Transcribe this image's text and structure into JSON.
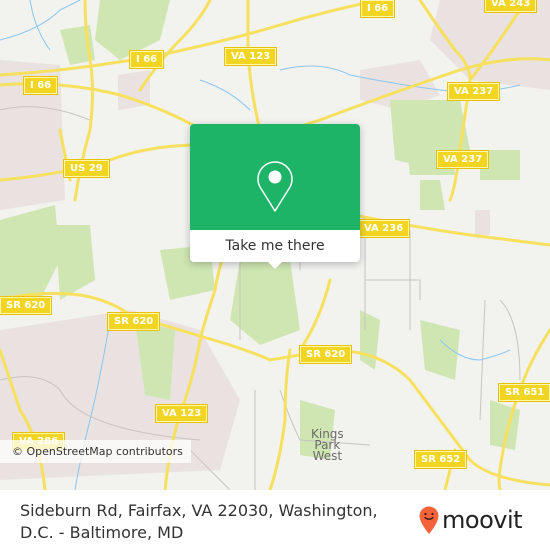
{
  "map": {
    "road_labels": [
      {
        "id": "i66-top",
        "text": "I 66"
      },
      {
        "id": "i66-mid",
        "text": "I 66"
      },
      {
        "id": "i66-left",
        "text": "I 66"
      },
      {
        "id": "va123-top",
        "text": "VA 123"
      },
      {
        "id": "va243",
        "text": "VA 243"
      },
      {
        "id": "va237-upper",
        "text": "VA 237"
      },
      {
        "id": "va237-lower",
        "text": "VA 237"
      },
      {
        "id": "us29",
        "text": "US 29"
      },
      {
        "id": "va236",
        "text": "VA 236"
      },
      {
        "id": "sr620-left",
        "text": "SR 620"
      },
      {
        "id": "sr620-mid",
        "text": "SR 620"
      },
      {
        "id": "sr620-right",
        "text": "SR 620"
      },
      {
        "id": "va123-bottom",
        "text": "VA 123"
      },
      {
        "id": "va286",
        "text": "VA 286"
      },
      {
        "id": "sr651",
        "text": "SR 651"
      },
      {
        "id": "sr652",
        "text": "SR 652"
      }
    ],
    "place_labels": [
      {
        "id": "kings-park-west",
        "lines": [
          "Kings",
          "Park",
          "West"
        ]
      }
    ],
    "attribution": "© OpenStreetMap contributors",
    "colors": {
      "background": "#f2f2ef",
      "park": "#c9e3a9",
      "urban": "#e8e0df",
      "road_major": "#f6e05e",
      "water": "#8cc6f0"
    }
  },
  "popup": {
    "button_label": "Take me there",
    "icon": "map-pin-icon",
    "color": "#1db468"
  },
  "footer": {
    "address": "Sideburn Rd, Fairfax, VA 22030, Washington, D.C. - Baltimore, MD",
    "brand": "moovit",
    "brand_icon": "moovit-smiley-pin-icon",
    "brand_color": "#f4623a"
  }
}
